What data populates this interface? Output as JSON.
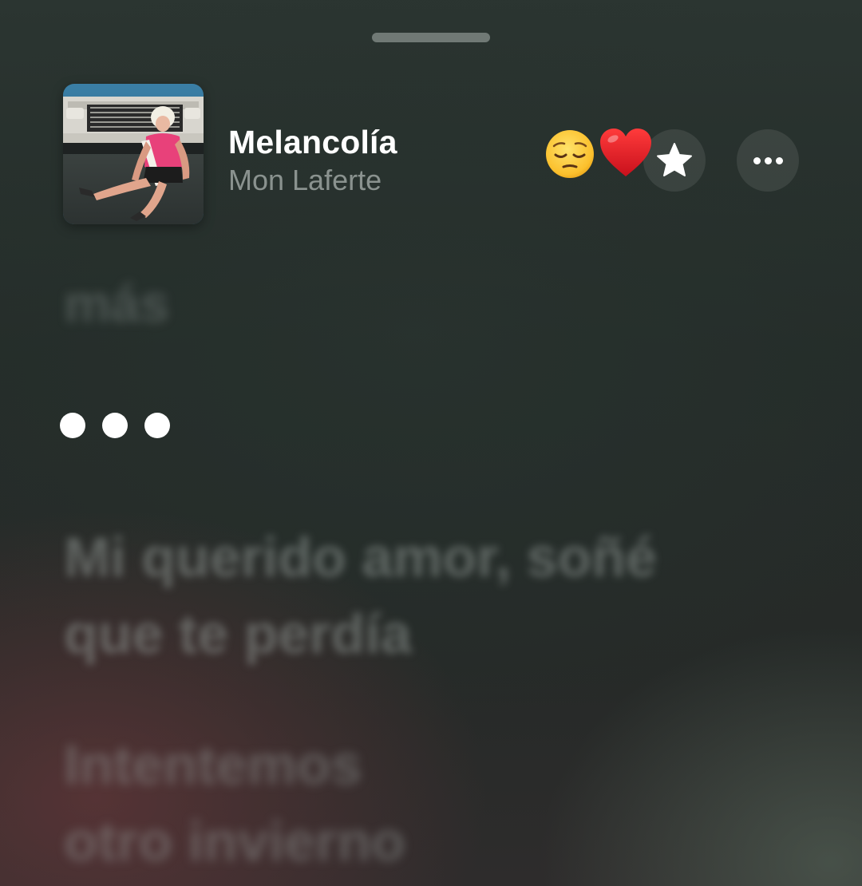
{
  "now_playing": {
    "title": "Melancolía",
    "artist": "Mon Laferte",
    "artwork_icon": "album-artwork",
    "reactions": [
      "pensive-face-emoji",
      "red-heart-emoji"
    ],
    "buttons": {
      "favorite_icon": "star-icon",
      "more_icon": "ellipsis-icon"
    }
  },
  "lyrics": {
    "previous_line": "más",
    "interlude_icon": "ellipsis-interlude",
    "upcoming": [
      {
        "lines": [
          "Mi querido amor, soñé",
          "que te perdía"
        ]
      },
      {
        "lines": [
          "Intentemos",
          "otro invierno"
        ]
      }
    ]
  },
  "colors": {
    "heart": "#e8202a",
    "title": "#ffffff",
    "artist": "#a5aca8"
  }
}
